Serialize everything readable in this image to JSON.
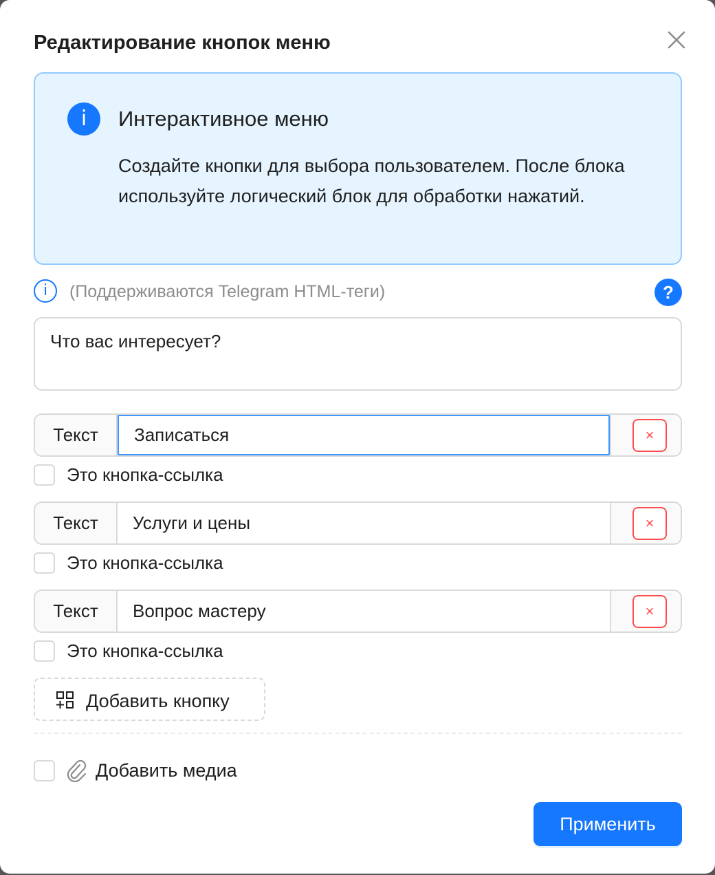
{
  "dialog": {
    "title": "Редактирование кнопок меню",
    "close_icon": "close-icon"
  },
  "info": {
    "icon": "info-icon",
    "icon_glyph": "i",
    "title": "Интерактивное меню",
    "description": "Создайте кнопки для выбора пользователем. После блока используйте логический блок для обработки нажатий."
  },
  "hint": {
    "icon_glyph": "i",
    "text": "(Поддерживаются Telegram HTML-теги)",
    "help_glyph": "?"
  },
  "message": {
    "value": "Что вас интересует?"
  },
  "buttons": [
    {
      "addon": "Текст",
      "value": "Записаться",
      "delete_glyph": "×",
      "link_label": "Это кнопка-ссылка",
      "focused": true
    },
    {
      "addon": "Текст",
      "value": "Услуги и цены",
      "delete_glyph": "×",
      "link_label": "Это кнопка-ссылка",
      "focused": false
    },
    {
      "addon": "Текст",
      "value": "Вопрос мастеру",
      "delete_glyph": "×",
      "link_label": "Это кнопка-ссылка",
      "focused": false
    }
  ],
  "add_button": {
    "label": "Добавить кнопку",
    "icon": "add-grid-icon"
  },
  "media": {
    "label": "Добавить медиа",
    "icon": "paperclip-icon"
  },
  "footer": {
    "apply_label": "Применить"
  },
  "colors": {
    "primary": "#1677ff",
    "info_bg": "#e6f4ff",
    "info_border": "#91caff",
    "danger": "#ff4d4f"
  }
}
